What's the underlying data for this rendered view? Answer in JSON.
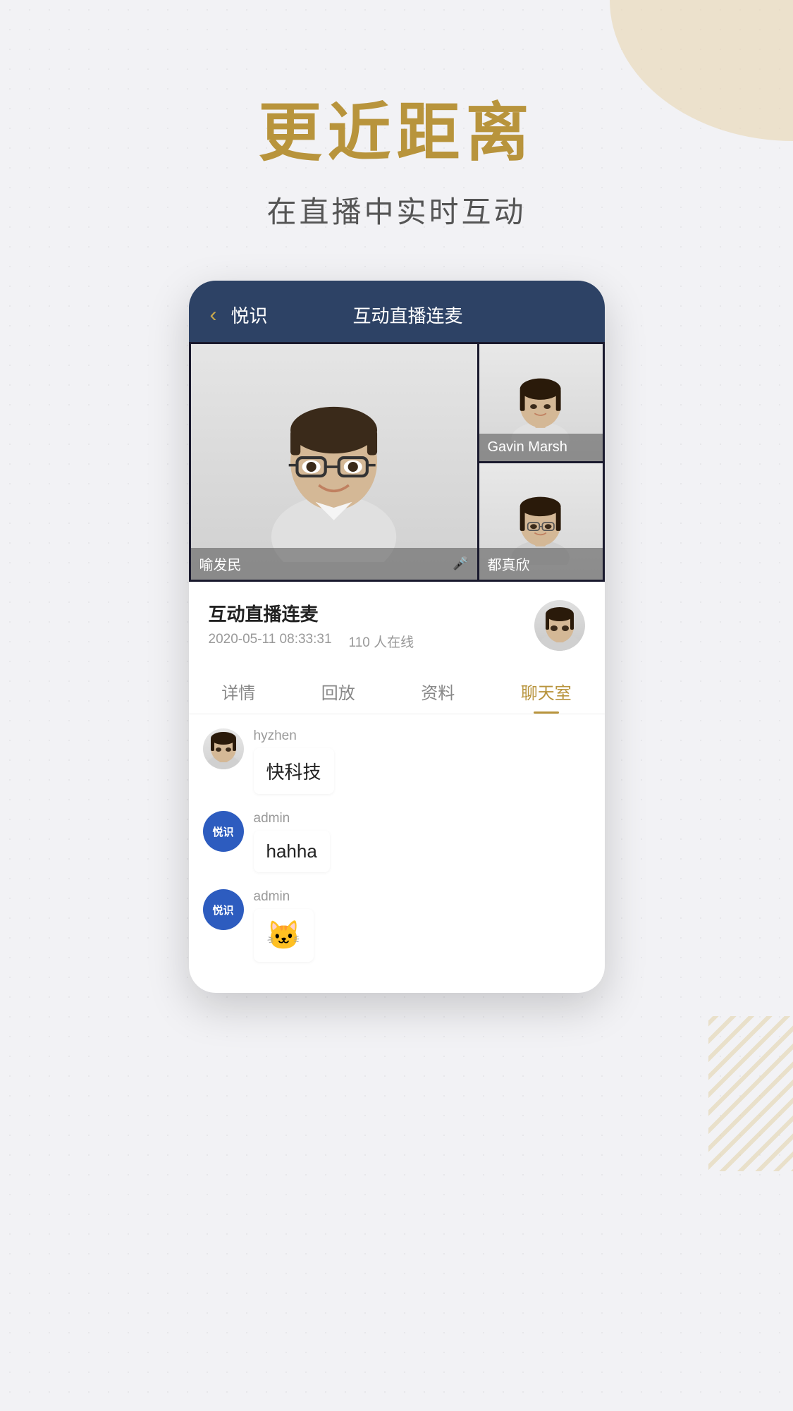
{
  "page": {
    "bg_color": "#f2f2f5",
    "main_title": "更近距离",
    "sub_title": "在直播中实时互动"
  },
  "app_header": {
    "back_label": "‹",
    "app_name": "悦识",
    "live_title": "互动直播连麦"
  },
  "video": {
    "main_person_name": "喻发民",
    "side_top_name": "Gavin Marsh",
    "side_bottom_name": "都真欣"
  },
  "live_info": {
    "title": "互动直播连麦",
    "datetime": "2020-05-11 08:33:31",
    "online_count": "110 人在线"
  },
  "tabs": [
    {
      "label": "详情",
      "active": false
    },
    {
      "label": "回放",
      "active": false
    },
    {
      "label": "资料",
      "active": false
    },
    {
      "label": "聊天室",
      "active": true
    }
  ],
  "chat_messages": [
    {
      "username": "hyzhen",
      "avatar_type": "photo",
      "text": "快科技",
      "emoji": null
    },
    {
      "username": "admin",
      "avatar_type": "logo",
      "text": "hahha",
      "emoji": null
    },
    {
      "username": "admin",
      "avatar_type": "logo",
      "text": null,
      "emoji": "🐱"
    }
  ],
  "icons": {
    "mic": "🎤",
    "yueshi_logo": "悦识"
  }
}
